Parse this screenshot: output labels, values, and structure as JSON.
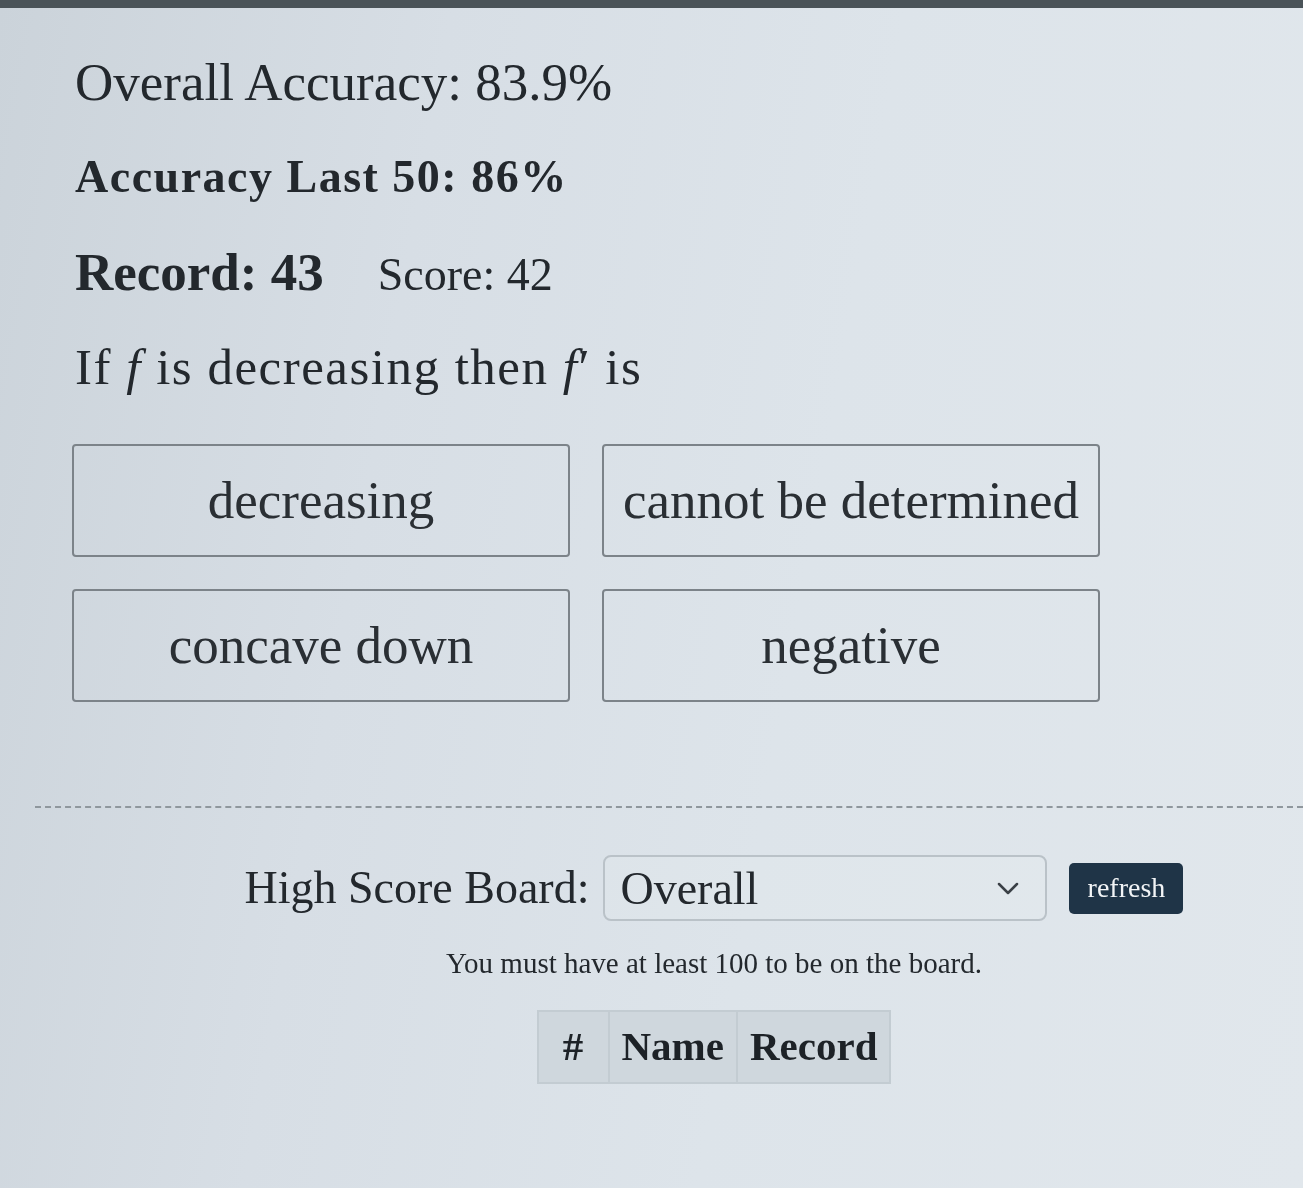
{
  "stats": {
    "overall_accuracy": "Overall Accuracy: 83.9%",
    "accuracy_last_50": "Accuracy Last 50: 86%",
    "record": "Record: 43",
    "score": "Score: 42"
  },
  "question": {
    "text": "If *f* is decreasing then *f*′ is",
    "answers": [
      {
        "label": "decreasing"
      },
      {
        "label": "cannot be determined"
      },
      {
        "label": "concave down"
      },
      {
        "label": "negative"
      }
    ]
  },
  "high_score_board": {
    "label": "High Score Board:",
    "dropdown": {
      "value": "Overall"
    },
    "refresh_button": "refresh",
    "notice": "You must have at least 100 to be on the board.",
    "table": {
      "columns": [
        "#",
        "Name",
        "Record"
      ]
    }
  }
}
